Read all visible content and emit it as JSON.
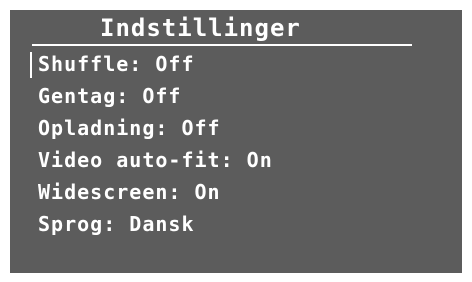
{
  "menu": {
    "title": "Indstillinger",
    "items": [
      {
        "label": "Shuffle: Off",
        "selected": true
      },
      {
        "label": "Gentag: Off",
        "selected": false
      },
      {
        "label": "Opladning: Off",
        "selected": false
      },
      {
        "label": "Video auto-fit: On",
        "selected": false
      },
      {
        "label": "Widescreen: On",
        "selected": false
      },
      {
        "label": "Sprog: Dansk",
        "selected": false
      }
    ]
  },
  "colors": {
    "background": "#5c5c5c",
    "text": "#ffffff"
  }
}
